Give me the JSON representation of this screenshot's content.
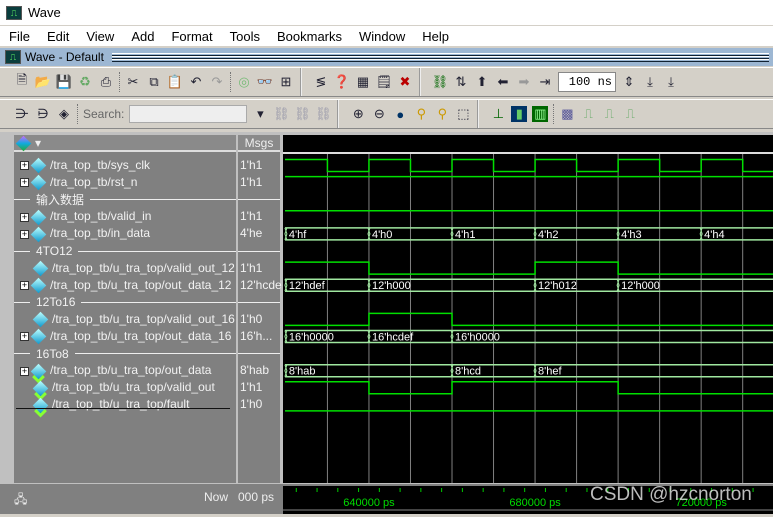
{
  "window": {
    "title": "Wave",
    "subtitle": "Wave - Default"
  },
  "menu": [
    "File",
    "Edit",
    "View",
    "Add",
    "Format",
    "Tools",
    "Bookmarks",
    "Window",
    "Help"
  ],
  "toolbar": {
    "search_label": "Search:",
    "search_value": "",
    "time_step": "100 ns"
  },
  "header": {
    "msgs": "Msgs"
  },
  "rows": [
    {
      "type": "signal",
      "name": "/tra_top_tb/sys_clk",
      "msg": "1'h1",
      "expand": true,
      "out": false
    },
    {
      "type": "signal",
      "name": "/tra_top_tb/rst_n",
      "msg": "1'h1",
      "expand": true,
      "out": false
    },
    {
      "type": "divider",
      "name": "输入数据"
    },
    {
      "type": "signal",
      "name": "/tra_top_tb/valid_in",
      "msg": "1'h1",
      "expand": true,
      "out": false
    },
    {
      "type": "signal",
      "name": "/tra_top_tb/in_data",
      "msg": "4'he",
      "expand": true,
      "out": false
    },
    {
      "type": "divider",
      "name": "4TO12"
    },
    {
      "type": "signal",
      "name": "/tra_top_tb/u_tra_top/valid_out_12",
      "msg": "1'h1",
      "expand": false,
      "out": false
    },
    {
      "type": "signal",
      "name": "/tra_top_tb/u_tra_top/out_data_12",
      "msg": "12'hcde",
      "expand": true,
      "out": false
    },
    {
      "type": "divider",
      "name": "12To16"
    },
    {
      "type": "signal",
      "name": "/tra_top_tb/u_tra_top/valid_out_16",
      "msg": "1'h0",
      "expand": false,
      "out": false
    },
    {
      "type": "signal",
      "name": "/tra_top_tb/u_tra_top/out_data_16",
      "msg": "16'h...",
      "expand": true,
      "out": false
    },
    {
      "type": "divider",
      "name": "16To8"
    },
    {
      "type": "signal",
      "name": "/tra_top_tb/u_tra_top/out_data",
      "msg": "8'hab",
      "expand": true,
      "out": true
    },
    {
      "type": "signal",
      "name": "/tra_top_tb/u_tra_top/valid_out",
      "msg": "1'h1",
      "expand": false,
      "out": true
    },
    {
      "type": "signal",
      "name": "/tra_top_tb/u_tra_top/fault",
      "msg": "1'h0",
      "expand": false,
      "out": true
    }
  ],
  "waves": {
    "view_start_ps": 619300,
    "view_end_ps": 737300,
    "signals": [
      {
        "row": 0,
        "kind": "bit",
        "changes": [
          [
            619300,
            1
          ],
          [
            630000,
            0
          ],
          [
            640000,
            1
          ],
          [
            650000,
            0
          ],
          [
            660000,
            1
          ],
          [
            670000,
            0
          ],
          [
            680000,
            1
          ],
          [
            690000,
            0
          ],
          [
            700000,
            1
          ],
          [
            710000,
            0
          ],
          [
            720000,
            1
          ],
          [
            730000,
            0
          ]
        ]
      },
      {
        "row": 1,
        "kind": "bit",
        "changes": [
          [
            619300,
            1
          ]
        ]
      },
      {
        "row": 3,
        "kind": "bit",
        "changes": [
          [
            619300,
            1
          ]
        ]
      },
      {
        "row": 4,
        "kind": "bus",
        "changes": [
          [
            620000,
            "4'hf"
          ],
          [
            640000,
            "4'h0"
          ],
          [
            660000,
            "4'h1"
          ],
          [
            680000,
            "4'h2"
          ],
          [
            700000,
            "4'h3"
          ],
          [
            720000,
            "4'h4"
          ]
        ]
      },
      {
        "row": 6,
        "kind": "bit",
        "changes": [
          [
            619300,
            1
          ],
          [
            640000,
            0
          ],
          [
            680000,
            1
          ],
          [
            700000,
            0
          ]
        ]
      },
      {
        "row": 7,
        "kind": "bus",
        "changes": [
          [
            620000,
            "12'hdef"
          ],
          [
            640000,
            "12'h000"
          ],
          [
            680000,
            "12'h012"
          ],
          [
            700000,
            "12'h000"
          ]
        ]
      },
      {
        "row": 9,
        "kind": "bit",
        "changes": [
          [
            619300,
            0
          ],
          [
            640000,
            1
          ],
          [
            660000,
            0
          ]
        ]
      },
      {
        "row": 10,
        "kind": "bus",
        "changes": [
          [
            620000,
            "16'h0000"
          ],
          [
            640000,
            "16'hcdef"
          ],
          [
            660000,
            "16'h0000"
          ]
        ]
      },
      {
        "row": 12,
        "kind": "bus",
        "changes": [
          [
            620000,
            "8'hab"
          ],
          [
            660000,
            "8'hcd"
          ],
          [
            680000,
            "8'hef"
          ]
        ]
      },
      {
        "row": 13,
        "kind": "bit",
        "changes": [
          [
            619300,
            1
          ],
          [
            640000,
            0
          ],
          [
            660000,
            1
          ],
          [
            700000,
            0
          ]
        ]
      },
      {
        "row": 14,
        "kind": "bit",
        "changes": [
          [
            619300,
            0
          ]
        ]
      }
    ],
    "grid_ps": [
      630000,
      640000,
      650000,
      660000,
      670000,
      680000,
      690000,
      700000,
      710000,
      720000,
      730000
    ]
  },
  "timeline": {
    "now_label": "Now",
    "now_value": "000 ps",
    "ticks": [
      {
        "t": 640000,
        "label": "640000 ps"
      },
      {
        "t": 680000,
        "label": "680000 ps"
      },
      {
        "t": 720000,
        "label": "720000 ps"
      }
    ]
  },
  "colors": {
    "wave": "#00e000",
    "bus": "#a0e8a0",
    "grid": "#808080",
    "text": "#ffffff"
  },
  "watermark": "CSDN @hzcnorton"
}
